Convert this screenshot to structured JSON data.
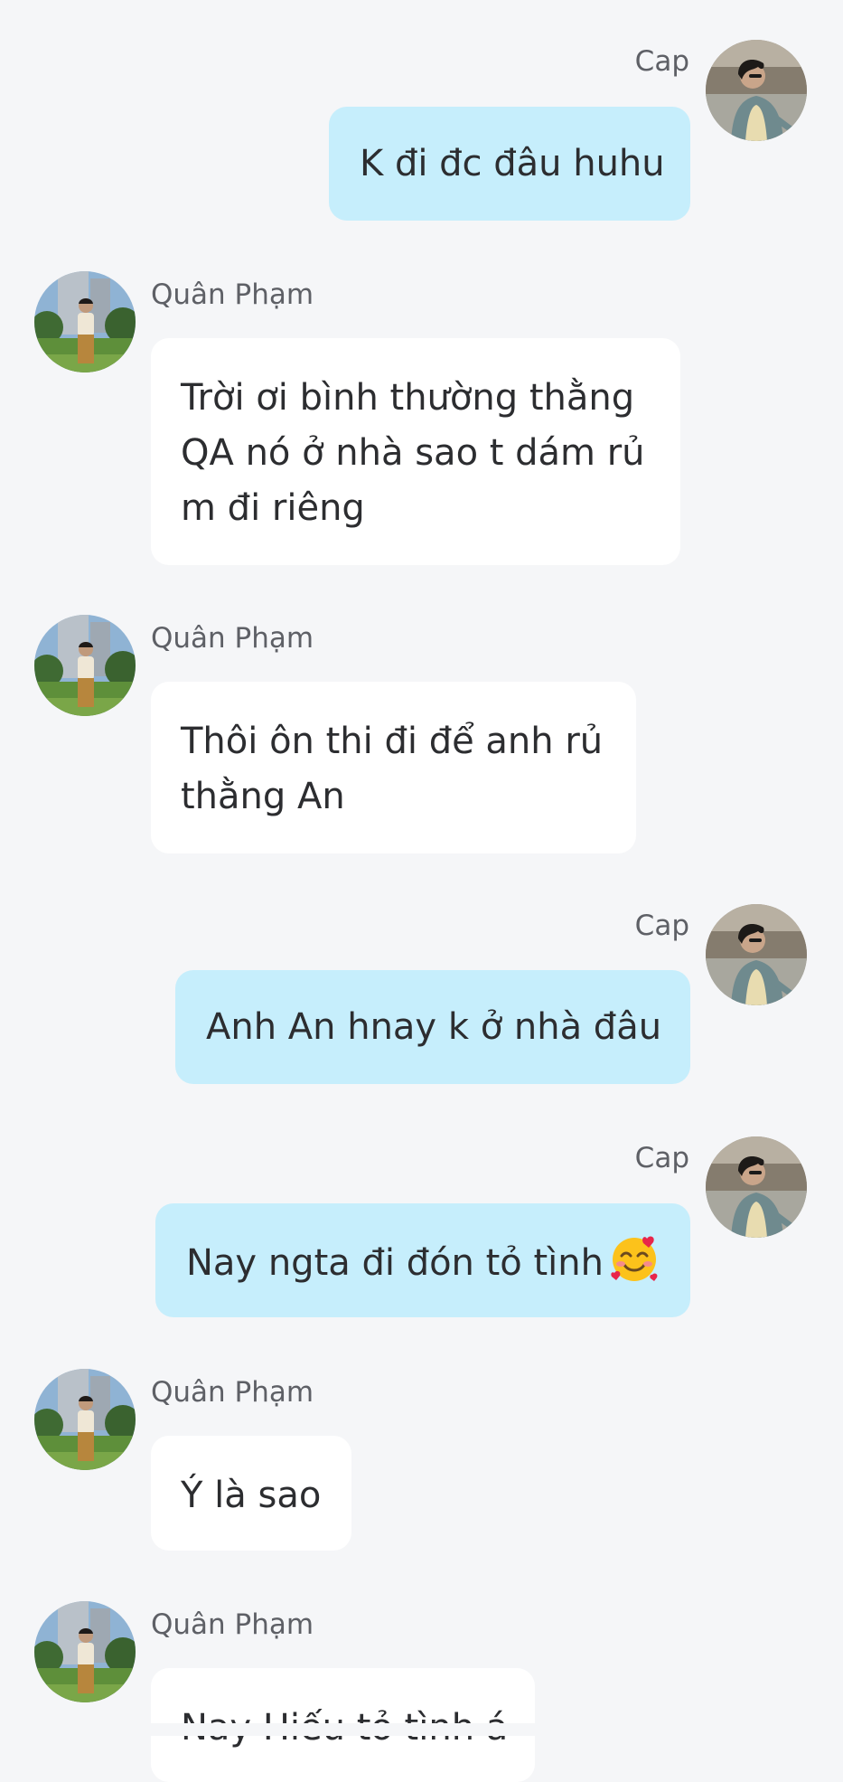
{
  "contacts": {
    "me": {
      "name": "Cap"
    },
    "other": {
      "name": "Quân Phạm"
    }
  },
  "colors": {
    "outgoing_bubble": "#c6eefc",
    "incoming_bubble": "#ffffff",
    "background": "#f5f6f8"
  },
  "messages": [
    {
      "sender": "Cap",
      "lines": [
        "K đi đc đâu huhu"
      ]
    },
    {
      "sender": "Quân Phạm",
      "lines": [
        "Trời ơi bình thường thằng",
        "QA nó ở nhà sao t dám rủ",
        "m đi riêng"
      ]
    },
    {
      "sender": "Quân Phạm",
      "lines": [
        "Thôi ôn thi đi để anh rủ",
        "thằng An"
      ]
    },
    {
      "sender": "Cap",
      "lines": [
        "Anh An hnay k ở nhà đâu"
      ]
    },
    {
      "sender": "Cap",
      "lines": [
        "Nay ngta đi đón tỏ tình"
      ],
      "emoji": "smiling-face-with-hearts-icon"
    },
    {
      "sender": "Quân Phạm",
      "lines": [
        "Ý là sao"
      ]
    },
    {
      "sender": "Quân Phạm",
      "lines": [
        "Nay Hiếu tỏ tình á"
      ]
    }
  ]
}
